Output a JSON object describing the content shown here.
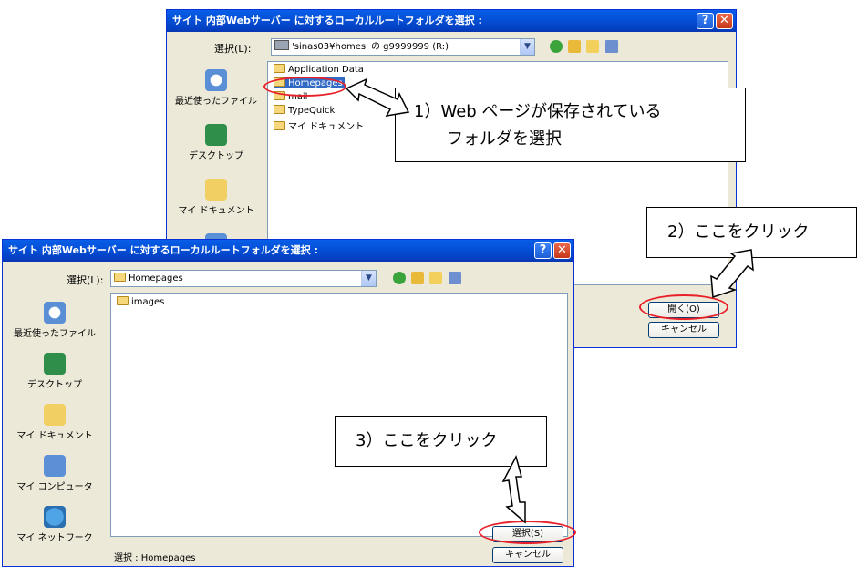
{
  "dialog_back": {
    "title": "サイト 内部Webサーバー に対するローカルルートフォルダを選択 :",
    "select_label": "選択(L):",
    "location": "'sinas03¥homes' の g9999999 (R:)",
    "places": [
      "最近使ったファイル",
      "デスクトップ",
      "マイ ドキュメント"
    ],
    "files": [
      "Application Data",
      "Homepages",
      "mail",
      "TypeQuick",
      "マイ ドキュメント"
    ],
    "open_button": "開く(O)",
    "cancel_button": "キャンセル"
  },
  "dialog_front": {
    "title": "サイト 内部Webサーバー に対するローカルルートフォルダを選択 :",
    "select_label": "選択(L):",
    "location": "Homepages",
    "places": [
      "最近使ったファイル",
      "デスクトップ",
      "マイ ドキュメント",
      "マイ コンピュータ",
      "マイ ネットワーク"
    ],
    "files": [
      "images"
    ],
    "status": "選択 : Homepages",
    "select_button": "選択(S)",
    "cancel_button": "キャンセル"
  },
  "callouts": {
    "step1_line1": "1）Web ページが保存されている",
    "step1_line2": "フォルダを選択",
    "step2": "2）ここをクリック",
    "step3": "3）ここをクリック"
  },
  "colors": {
    "title_bar": "#0451d8",
    "dialog_face": "#ece9d8",
    "highlight_oval": "#e8202a"
  },
  "icons": {
    "up": "green-arrow-icon",
    "folder_up": "folder-up-icon",
    "new_folder": "new-folder-icon",
    "view_menu": "view-menu-icon"
  }
}
